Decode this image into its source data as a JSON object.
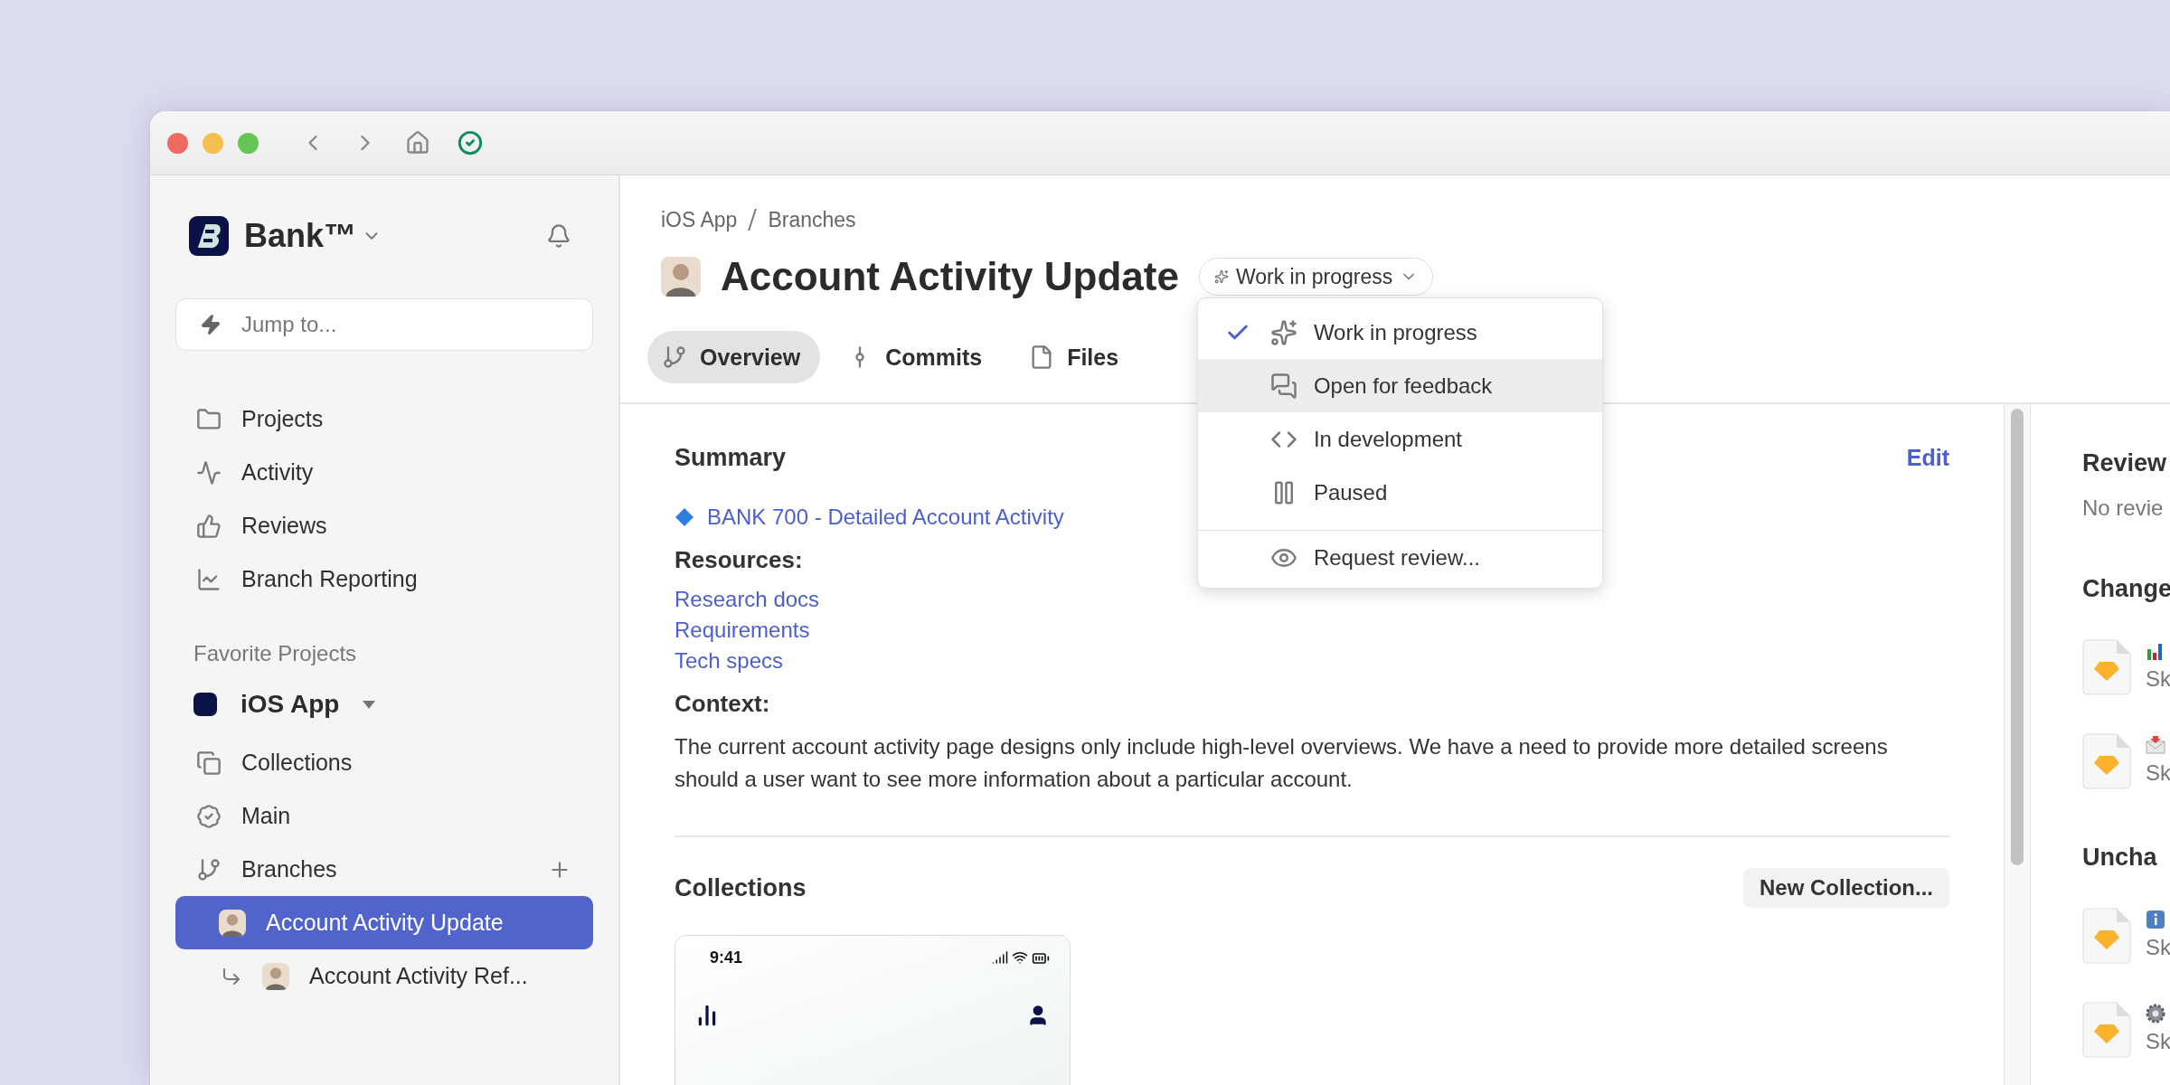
{
  "sidebar": {
    "workspace": {
      "name": "Bank™"
    },
    "search": {
      "placeholder": "Jump to..."
    },
    "nav": [
      {
        "label": "Projects",
        "kind": "folder"
      },
      {
        "label": "Activity",
        "kind": "activity"
      },
      {
        "label": "Reviews",
        "kind": "thumbs_up"
      },
      {
        "label": "Branch Reporting",
        "kind": "chart"
      }
    ],
    "favorites": {
      "heading": "Favorite Projects",
      "project": {
        "name": "iOS App",
        "color": "#0b1247",
        "expanded": true
      },
      "items": [
        {
          "label": "Collections",
          "kind": "collections",
          "can_add": false
        },
        {
          "label": "Main",
          "kind": "badge",
          "can_add": false
        },
        {
          "label": "Branches",
          "kind": "branch",
          "can_add": true,
          "children": [
            {
              "label": "Account Activity Update",
              "selected": true,
              "children": [
                {
                  "label": "Account Activity Ref...",
                  "selected": false
                }
              ]
            }
          ]
        }
      ]
    }
  },
  "main": {
    "breadcrumb": [
      "iOS App",
      "Branches"
    ],
    "title": "Account Activity Update",
    "status": {
      "label": "Work in progress",
      "menu_open": true
    },
    "status_menu": [
      {
        "label": "Work in progress",
        "kind": "sparkles",
        "checked": true,
        "highlighted": false
      },
      {
        "label": "Open for feedback",
        "kind": "messages",
        "checked": false,
        "highlighted": true
      },
      {
        "label": "In development",
        "kind": "code",
        "checked": false,
        "highlighted": false
      },
      {
        "label": "Paused",
        "kind": "pause",
        "checked": false,
        "highlighted": false
      },
      {
        "label": "Request review...",
        "kind": "eye",
        "checked": false,
        "highlighted": false
      }
    ],
    "tabs": [
      {
        "label": "Overview",
        "kind": "branch",
        "selected": true
      },
      {
        "label": "Commits",
        "kind": "commit",
        "selected": false
      },
      {
        "label": "Files",
        "kind": "file",
        "selected": false
      }
    ],
    "summary": {
      "heading": "Summary",
      "edit": "Edit",
      "issue_link": "BANK 700 - Detailed Account Activity",
      "resources_heading": "Resources:",
      "resources": [
        "Research docs",
        "Requirements",
        "Tech specs"
      ],
      "context_heading": "Context:",
      "context": "The current account activity page designs only include high-level overviews. We have a need to provide more detailed screens should a user want to see more information about a particular account."
    },
    "collections": {
      "heading": "Collections",
      "button": "New Collection...",
      "cards": [
        {
          "time": "9:41"
        }
      ]
    }
  },
  "right_panel": {
    "sections": [
      {
        "heading": "Review",
        "empty_text": "No revie"
      },
      {
        "heading": "Change",
        "files": [
          {
            "kind": "chart",
            "subtitle": "Sk"
          },
          {
            "kind": "mail",
            "subtitle": "Sk"
          }
        ]
      },
      {
        "heading": "Uncha",
        "files": [
          {
            "kind": "info",
            "subtitle": "Sk"
          },
          {
            "kind": "gear",
            "subtitle": "Sk"
          }
        ]
      }
    ]
  }
}
